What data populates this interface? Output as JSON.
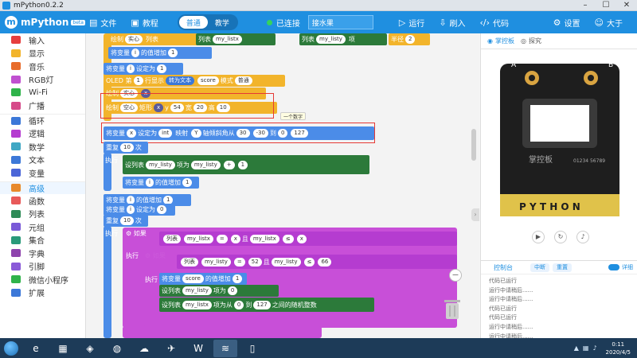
{
  "window": {
    "title": "mPython0.2.2"
  },
  "toolbar": {
    "logo_text": "mPython",
    "logo_badge": "beta",
    "file": "文件",
    "tutorial": "教程",
    "mode_normal": "普通",
    "mode_teach": "教学",
    "connection": "已连接",
    "filename": "接水果",
    "run": "运行",
    "flash": "刷入",
    "code": "代码",
    "settings": "设置",
    "user": "大于"
  },
  "sidebar": {
    "categories": [
      {
        "label": "输入",
        "color": "#e63e3e"
      },
      {
        "label": "显示",
        "color": "#f2b42b"
      },
      {
        "label": "音乐",
        "color": "#e86c2b"
      },
      {
        "label": "RGB灯",
        "color": "#c050d0"
      },
      {
        "label": "Wi-Fi",
        "color": "#2fb34a"
      },
      {
        "label": "广播",
        "color": "#d64a8a"
      },
      {
        "label": "循环",
        "color": "#3c78d8"
      },
      {
        "label": "逻辑",
        "color": "#b53cd0"
      },
      {
        "label": "数学",
        "color": "#3fa7c4"
      },
      {
        "label": "文本",
        "color": "#3c78d8"
      },
      {
        "label": "变量",
        "color": "#4b66d8"
      },
      {
        "label": "高级",
        "color": "#e8892b"
      },
      {
        "label": "函数",
        "color": "#e85a5a"
      },
      {
        "label": "列表",
        "color": "#2e8b57"
      },
      {
        "label": "元组",
        "color": "#7a5ad8"
      },
      {
        "label": "集合",
        "color": "#2a9a7a"
      },
      {
        "label": "字典",
        "color": "#8e44ad"
      },
      {
        "label": "引脚",
        "color": "#8a5ad8"
      },
      {
        "label": "微信小程序",
        "color": "#2fb34a"
      },
      {
        "label": "扩展",
        "color": "#3c78d8"
      }
    ]
  },
  "blocks": {
    "draw_top": "绘制",
    "solid": "实心",
    "list": "列表",
    "my_listx": "my_listx",
    "my_listy": "my_listy",
    "item": "项",
    "get": "第",
    "radius": "半径",
    "radius_val": "2",
    "set_var": "将变量",
    "var_i": "i",
    "increase": "的值增加",
    "one": "1",
    "set_to": "设定为",
    "zero": "0",
    "oled": "OLED 第",
    "line": "行显示",
    "to_text": "转为文本",
    "score": "score",
    "mode_label": "模式",
    "mode_val": "普通",
    "draw": "绘制",
    "hollow": "空心",
    "rect": "矩形",
    "x_lbl": "x",
    "y_lbl": "y",
    "v54": "54",
    "width": "宽",
    "v20": "20",
    "height": "高",
    "v10": "10",
    "int": "int",
    "map": "映射",
    "accel_y": "Y",
    "tilt": "轴倾斜角",
    "from": "从",
    "v30": "30",
    "vneg30": "-30",
    "to": "到",
    "v127": "127",
    "repeat": "重复",
    "times": "次",
    "execute": "执行",
    "set": "设列表",
    "item_set": "项为",
    "plus": "+",
    "if": "如果",
    "eq": "=",
    "le": "≤",
    "and": "且",
    "v52": "52",
    "v66": "66",
    "score_inc": "score",
    "random": "之间的随机整数",
    "tooltip": "一个数字"
  },
  "panel": {
    "tab_board": "掌控板",
    "tab_explore": "探究",
    "board_text": "掌控板",
    "board_serial": "01234 56789",
    "console_title": "控制台",
    "btn_middle": "中断",
    "btn_reset": "重置",
    "toggle": "详细",
    "console_lines": [
      "代码已运行",
      "运行中请稍后......",
      "运行中请稍后......",
      "代码已运行",
      "代码已运行",
      "运行中请稍后......",
      "运行中请稍后......",
      "代码已运行"
    ]
  },
  "taskbar": {
    "time": "0:11",
    "date": "2020/4/5"
  }
}
